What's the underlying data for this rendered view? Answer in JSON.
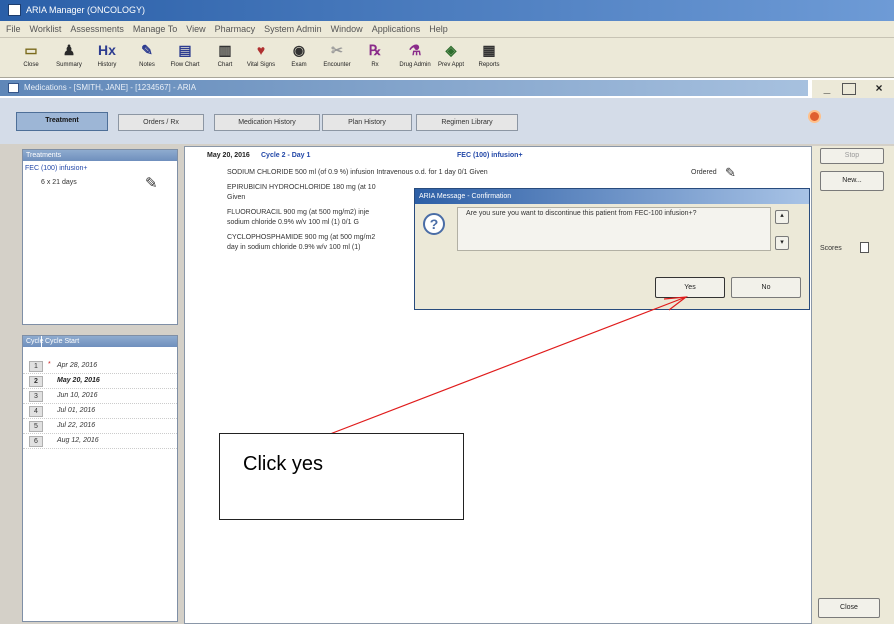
{
  "titlebar": {
    "title": "ARIA Manager (ONCOLOGY)"
  },
  "menubar": {
    "items": [
      "File",
      "Worklist",
      "Assessments",
      "Manage To",
      "View",
      "Pharmacy",
      "System Admin",
      "Window",
      "Applications",
      "Help"
    ]
  },
  "toolbar": {
    "buttons": [
      {
        "label": "Close",
        "icon": "folder-icon",
        "glyph": "▭",
        "color": "#7a6a1c"
      },
      {
        "label": "Summary",
        "icon": "summary-icon",
        "glyph": "♟",
        "color": "#2a2a2a"
      },
      {
        "label": "History",
        "icon": "history-icon",
        "glyph": "Hx",
        "color": "#2d3c90"
      },
      {
        "label": "Notes",
        "icon": "notes-icon",
        "glyph": "✎",
        "color": "#2d3c90"
      },
      {
        "label": "Flow Chart",
        "icon": "flowchart-icon",
        "glyph": "▤",
        "color": "#2d3c90"
      },
      {
        "label": "Chart",
        "icon": "chart-icon",
        "glyph": "▥",
        "color": "#333"
      },
      {
        "label": "Vital Signs",
        "icon": "vitals-icon",
        "glyph": "♥",
        "color": "#b03030"
      },
      {
        "label": "Exam",
        "icon": "exam-icon",
        "glyph": "◉",
        "color": "#333"
      },
      {
        "label": "Encounter",
        "icon": "encounter-icon",
        "glyph": "✂",
        "color": "#999"
      },
      {
        "label": "Rx",
        "icon": "rx-icon",
        "glyph": "℞",
        "color": "#8a2b8a"
      },
      {
        "label": "Drug Admin",
        "icon": "drugadmin-icon",
        "glyph": "⚗",
        "color": "#8a2b8a"
      },
      {
        "label": "Prev Appt",
        "icon": "prevappt-icon",
        "glyph": "◈",
        "color": "#2d6d2d"
      },
      {
        "label": "Reports",
        "icon": "reports-icon",
        "glyph": "▦",
        "color": "#333"
      }
    ]
  },
  "window": {
    "subtitle": "Medications - [SMITH, JANE] - [1234567] - ARIA"
  },
  "tabs": [
    "Treatment",
    "Orders / Rx",
    "Medication History",
    "Plan History",
    "Regimen Library"
  ],
  "treatments": {
    "header": "Treatments",
    "item_name": "FEC (100) infusion+",
    "item_detail": "6 x 21 days"
  },
  "cycles": {
    "headers": [
      "Cycle",
      "Cycle Start"
    ],
    "rows": [
      {
        "num": "1",
        "start": "Apr 28, 2016",
        "marker": "*",
        "current": false
      },
      {
        "num": "2",
        "start": "May 20, 2016",
        "marker": "",
        "current": true
      },
      {
        "num": "3",
        "start": "Jun 10, 2016",
        "marker": "",
        "current": false
      },
      {
        "num": "4",
        "start": "Jul 01, 2016",
        "marker": "",
        "current": false
      },
      {
        "num": "5",
        "start": "Jul 22, 2016",
        "marker": "",
        "current": false
      },
      {
        "num": "6",
        "start": "Aug 12, 2016",
        "marker": "",
        "current": false
      }
    ]
  },
  "main": {
    "date": "May 20, 2016",
    "cycle": "Cycle 2 - Day 1",
    "regimen": "FEC (100) infusion+",
    "lines": [
      "SODIUM CHLORIDE 500 ml (of 0.9 %) infusion Intravenous o.d. for 1 day   0/1 Given",
      "EPIRUBICIN HYDROCHLORIDE 180 mg (at 10",
      "Given",
      "FLUOROURACIL 900 mg (at 500 mg/m2) inje",
      "sodium chloride 0.9% w/v 100 ml (1)   0/1 G",
      "CYCLOPHOSPHAMIDE 900 mg (at 500 mg/m2",
      "day in sodium chloride 0.9% w/v 100 ml (1)"
    ],
    "status": "Ordered"
  },
  "rightpanel": {
    "stop": "Stop",
    "new": "New...",
    "scores": "Scores",
    "close": "Close"
  },
  "dialog": {
    "title": "ARIA Message - Confirmation",
    "message": "Are you sure you want to discontinue this patient from FEC-100 infusion+?",
    "yes": "Yes",
    "no": "No"
  },
  "annotation": {
    "text": "Click yes"
  }
}
